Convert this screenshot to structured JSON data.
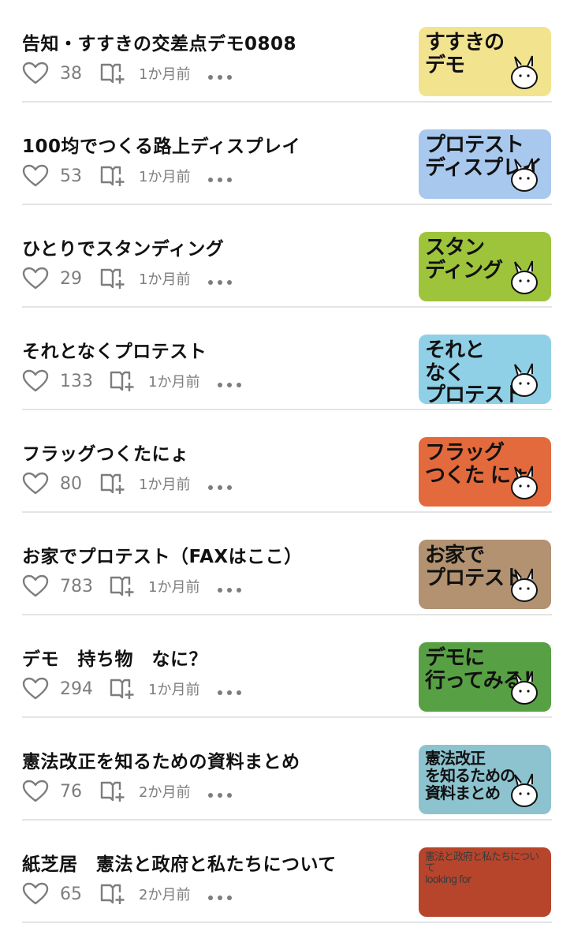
{
  "articles": [
    {
      "title": "告知・すすきの交差点デモ0808",
      "likes": "38",
      "time": "1か月前",
      "thumb_text": "すすきの\nデモ",
      "thumb_color": "#f2e38f"
    },
    {
      "title": "100均でつくる路上ディスプレイ",
      "likes": "53",
      "time": "1か月前",
      "thumb_text": "プロテスト\nディスプレイ",
      "thumb_color": "#a8c8ee"
    },
    {
      "title": "ひとりでスタンディング",
      "likes": "29",
      "time": "1か月前",
      "thumb_text": "スタン\nディング",
      "thumb_color": "#9ec43c"
    },
    {
      "title": "それとなくプロテスト",
      "likes": "133",
      "time": "1か月前",
      "thumb_text": "それと\nなく\nプロテスト",
      "thumb_color": "#8fd0e6"
    },
    {
      "title": "フラッグつくたにょ",
      "likes": "80",
      "time": "1か月前",
      "thumb_text": "フラッグ\nつくた にょ",
      "thumb_color": "#e36a3c"
    },
    {
      "title": "お家でプロテスト（FAXはここ）",
      "likes": "783",
      "time": "1か月前",
      "thumb_text": "お家で\nプロテスト",
      "thumb_color": "#b29271"
    },
    {
      "title": "デモ　持ち物　なに？",
      "likes": "294",
      "time": "1か月前",
      "thumb_text": "デモに\n行ってみる！",
      "thumb_color": "#58a044"
    },
    {
      "title": "憲法改正を知るための資料まとめ",
      "likes": "76",
      "time": "2か月前",
      "thumb_text": "憲法改正\nを知るための\n資料まとめ",
      "thumb_color": "#8cc3cf"
    },
    {
      "title": "紙芝居　憲法と政府と私たちについて",
      "likes": "65",
      "time": "2か月前",
      "thumb_text": "憲法と政府と私たちについて\nlooking for",
      "thumb_color": "#b6452c"
    }
  ]
}
